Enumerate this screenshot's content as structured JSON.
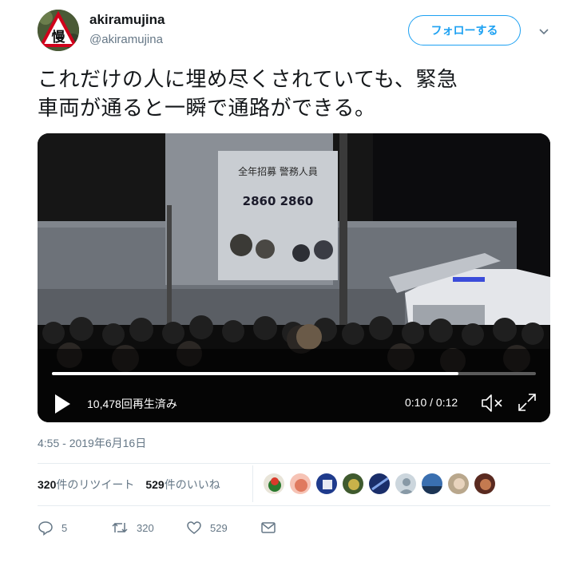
{
  "tweet": {
    "display_name": "akiramujina",
    "handle": "@akiramujina",
    "follow_label": "フォローする",
    "text_line1": "これだけの人に埋め尽くされていても、緊急",
    "text_line2": "車両が通ると一瞬で通路ができる。",
    "timestamp": "4:55 - 2019年6月16日"
  },
  "video": {
    "view_count": "10,478回再生済み",
    "time": "0:10 / 0:12",
    "progress": 0.84,
    "banner_title": "全年招募 警務人員",
    "banner_number": "2860 2860"
  },
  "stats": {
    "retweets_count": "320",
    "retweets_label": "件のリツイート",
    "likes_count": "529",
    "likes_label": "件のいいね"
  },
  "actions": {
    "reply_count": "5",
    "retweet_count": "320",
    "like_count": "529"
  },
  "colors": {
    "accent": "#1da1f2",
    "muted": "#657786",
    "divider": "#e6ecf0"
  },
  "icons": [
    "chevron-down-icon",
    "play-icon",
    "volume-muted-icon",
    "fullscreen-icon",
    "reply-icon",
    "retweet-icon",
    "like-icon",
    "message-icon"
  ]
}
